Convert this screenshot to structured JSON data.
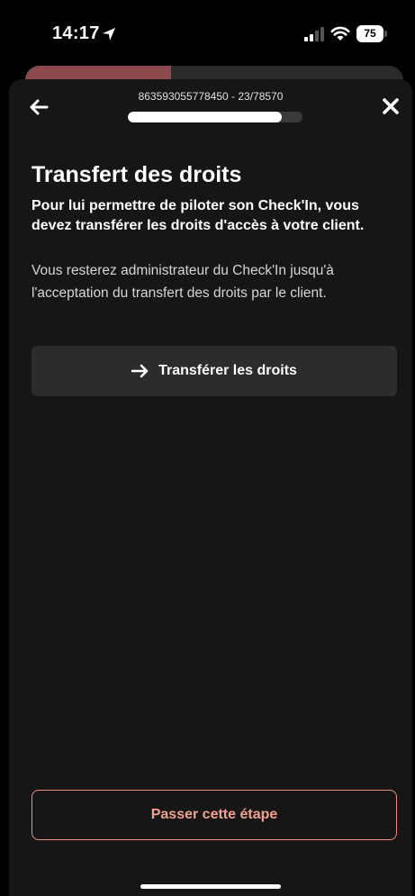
{
  "status_bar": {
    "time": "14:17",
    "battery": "75",
    "icons": [
      "location-arrow-icon",
      "cellular-signal-icon",
      "wifi-icon",
      "battery-icon"
    ]
  },
  "header": {
    "reference": "863593055778450 - 23/78570",
    "progress_fraction": 0.88,
    "back_icon": "arrow-left-icon",
    "close_icon": "close-icon"
  },
  "content": {
    "title": "Transfert des droits",
    "lead": "Pour lui permettre de piloter son Check'In, vous devez transférer les droits d'accès à votre client.",
    "description": "Vous resterez administrateur du Check'In jusqu'à l'acceptation du transfert des droits par le client."
  },
  "actions": {
    "primary_label": "Transférer les droits",
    "primary_icon": "arrow-right-icon",
    "skip_label": "Passer cette étape"
  },
  "colors": {
    "sheet_bg": "#161616",
    "button_bg": "#2c2c2c",
    "accent": "#e98d7c",
    "back_sheet_accent": "#8d4a4e"
  }
}
